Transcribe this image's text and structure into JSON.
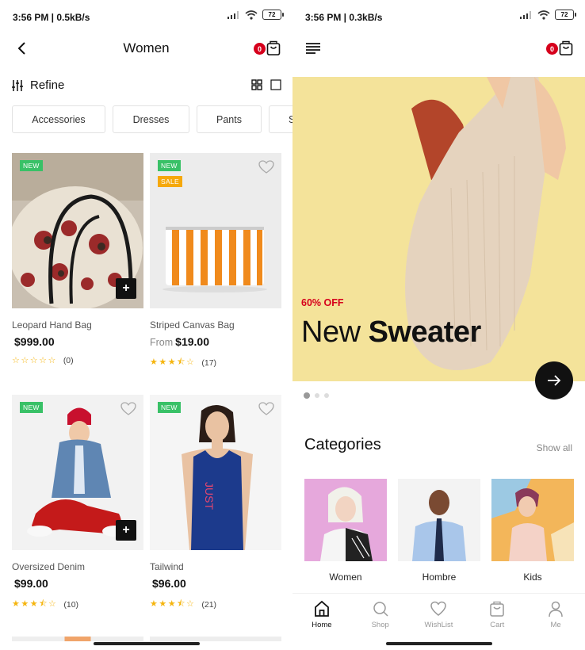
{
  "left": {
    "status": {
      "time": "3:56 PM | 0.5kB/s",
      "battery": "72"
    },
    "header": {
      "title": "Women",
      "cart_count": "0"
    },
    "refine_label": "Refine",
    "chips": [
      "Accessories",
      "Dresses",
      "Pants",
      "Sk"
    ],
    "products": [
      {
        "name": "Leopard Hand Bag",
        "price": "$999.00",
        "price_prefix": "",
        "stars": "☆☆☆☆☆",
        "reviews": "(0)",
        "tags": [
          "NEW"
        ]
      },
      {
        "name": "Striped Canvas Bag",
        "price": "$19.00",
        "price_prefix": "From",
        "stars": "★★★⯪☆",
        "reviews": "(17)",
        "tags": [
          "NEW",
          "SALE"
        ]
      },
      {
        "name": "Oversized Denim",
        "price": "$99.00",
        "price_prefix": "",
        "stars": "★★★⯪☆",
        "reviews": "(10)",
        "tags": [
          "NEW"
        ]
      },
      {
        "name": "Tailwind",
        "price": "$96.00",
        "price_prefix": "",
        "stars": "★★★⯪☆",
        "reviews": "(21)",
        "tags": [
          "NEW"
        ]
      }
    ]
  },
  "right": {
    "status": {
      "time": "3:56 PM | 0.3kB/s",
      "battery": "72"
    },
    "header": {
      "cart_count": "0"
    },
    "hero": {
      "offer": "60% OFF",
      "title_light": "New ",
      "title_bold": "Sweater"
    },
    "categories": {
      "title": "Categories",
      "show_all": "Show all",
      "items": [
        "Women",
        "Hombre",
        "Kids"
      ]
    },
    "nav": [
      "Home",
      "Shop",
      "WishList",
      "Cart",
      "Me"
    ],
    "active_nav": "Home"
  },
  "colors": {
    "accent_red": "#d6001c",
    "new_tag": "#39c167",
    "sale_tag": "#f5a80b",
    "star": "#f5b50f",
    "hero_bg": "#f4e39a"
  },
  "icons": [
    "back-icon",
    "cart-icon",
    "refine-icon",
    "grid-view-icon",
    "list-view-icon",
    "heart-icon",
    "plus-icon",
    "menu-icon",
    "arrow-right-icon",
    "home-icon",
    "search-icon",
    "heart-icon",
    "bag-icon",
    "user-icon"
  ]
}
